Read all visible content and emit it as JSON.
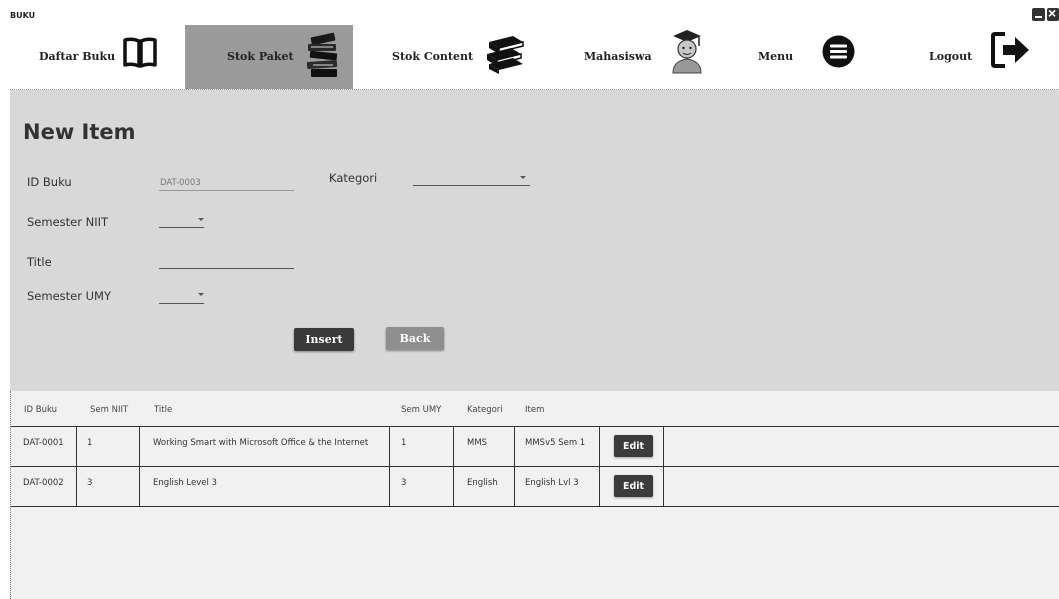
{
  "window": {
    "title": "BUKU"
  },
  "nav": {
    "daftar_buku": "Daftar Buku",
    "stok_paket": "Stok Paket",
    "stok_content": "Stok Content",
    "mahasiswa": "Mahasiswa",
    "menu": "Menu",
    "logout": "Logout"
  },
  "nav_icons": [
    "open-book-icon",
    "stacked-books-icon",
    "books-stack-icon",
    "graduate-student-icon",
    "hamburger-menu-icon",
    "logout-icon"
  ],
  "form": {
    "title": "New Item",
    "id_buku_label": "ID Buku",
    "id_buku_value": "DAT-0003",
    "kategori_label": "Kategori",
    "semester_niit_label": "Semester NIIT",
    "title_label": "Title",
    "semester_umy_label": "Semester UMY",
    "insert_label": "Insert",
    "back_label": "Back"
  },
  "table": {
    "headers": [
      "ID Buku",
      "Sem NIIT",
      "Title",
      "Sem UMY",
      "Kategori",
      "Item"
    ],
    "edit_label": "Edit",
    "rows": [
      [
        "DAT-0001",
        "1",
        "Working Smart with Microsoft Office & the Internet",
        "1",
        "MMS",
        "MMSv5 Sem 1"
      ],
      [
        "DAT-0002",
        "3",
        "English Level 3",
        "3",
        "English",
        "English Lvl 3"
      ]
    ]
  },
  "colors": {
    "active_nav": "#9a9a9a",
    "panel": "#d8d8d8",
    "button_dark": "#3a3a3a",
    "button_disabled": "#8f8f8f"
  }
}
